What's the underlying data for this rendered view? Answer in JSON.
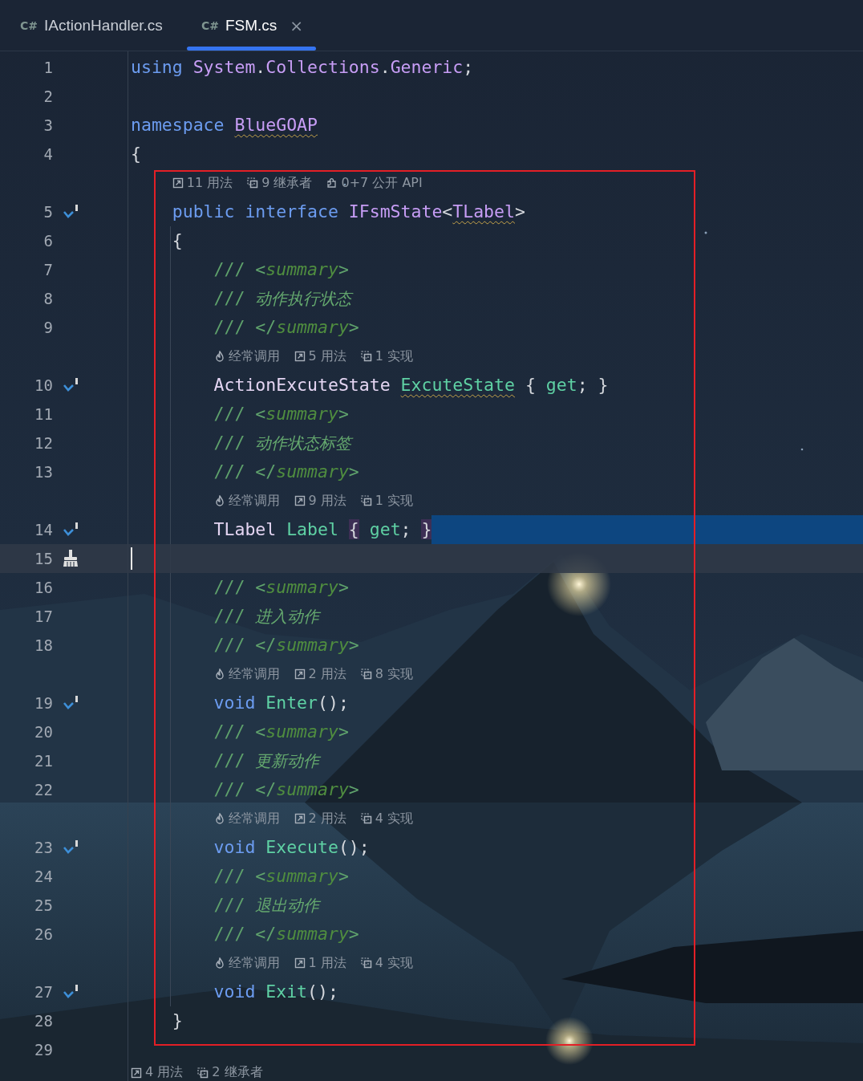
{
  "tabs": [
    {
      "lang": "C#",
      "label": "IActionHandler.cs",
      "selected": false
    },
    {
      "lang": "C#",
      "label": "FSM.cs",
      "selected": true,
      "close": "×"
    }
  ],
  "blocks": [
    {
      "boxed": false,
      "rows": [
        {
          "kind": "code",
          "number": "1",
          "tokens": [
            {
              "kind": "kw",
              "text": "using "
            },
            {
              "kind": "type",
              "text": "System"
            },
            {
              "kind": "p",
              "text": "."
            },
            {
              "kind": "type",
              "text": "Collections"
            },
            {
              "kind": "p",
              "text": "."
            },
            {
              "kind": "type",
              "text": "Generic"
            },
            {
              "kind": "p",
              "text": ";"
            }
          ]
        },
        {
          "kind": "code",
          "number": "2"
        },
        {
          "kind": "code",
          "number": "3",
          "tokens": [
            {
              "kind": "kw",
              "text": "namespace "
            },
            {
              "kind": "type",
              "text": "BlueGOAP",
              "squiggle": true
            }
          ]
        },
        {
          "kind": "code",
          "number": "4",
          "tokens": [
            {
              "kind": "p",
              "text": "{"
            }
          ]
        }
      ]
    },
    {
      "boxed": true,
      "rows": [
        {
          "kind": "hint",
          "items": [
            {
              "kind": "usages",
              "text": "11 用法"
            },
            {
              "kind": "inheritors",
              "text": "9 继承者"
            },
            {
              "kind": "api",
              "text": "0+7 公开 API"
            }
          ]
        },
        {
          "kind": "code",
          "number": "5",
          "gutter": {
            "kind": "implement"
          },
          "tokens": [
            {
              "kind": "kw",
              "text": "    public interface "
            },
            {
              "kind": "type",
              "text": "IFsmState"
            },
            {
              "kind": "p",
              "text": "<"
            },
            {
              "kind": "type",
              "text": "TLabel",
              "squiggle": true
            },
            {
              "kind": "p",
              "text": ">"
            }
          ]
        },
        {
          "kind": "code",
          "number": "6",
          "tokens": [
            {
              "kind": "p",
              "text": "    {"
            }
          ]
        },
        {
          "kind": "code",
          "number": "7",
          "tokens": [
            {
              "kind": "doc",
              "text": "        /// <"
            },
            {
              "kind": "tag",
              "text": "summary"
            },
            {
              "kind": "doc",
              "text": ">"
            }
          ]
        },
        {
          "kind": "code",
          "number": "8",
          "tokens": [
            {
              "kind": "doc",
              "text": "        /// "
            },
            {
              "kind": "note",
              "text": "动作执行状态"
            }
          ]
        },
        {
          "kind": "code",
          "number": "9",
          "tokens": [
            {
              "kind": "doc",
              "text": "        /// </"
            },
            {
              "kind": "tag",
              "text": "summary"
            },
            {
              "kind": "doc",
              "text": ">"
            }
          ]
        },
        {
          "kind": "hint",
          "items": [
            {
              "kind": "hot",
              "text": "经常调用"
            },
            {
              "kind": "usages",
              "text": "5 用法"
            },
            {
              "kind": "impl",
              "text": "1 实现"
            }
          ]
        },
        {
          "kind": "code",
          "number": "10",
          "gutter": {
            "kind": "implement"
          },
          "tokens": [
            {
              "kind": "name",
              "text": "        ActionExcuteState "
            },
            {
              "kind": "member",
              "text": "ExcuteState",
              "squiggle": true
            },
            {
              "kind": "p",
              "text": " { "
            },
            {
              "kind": "member",
              "text": "get"
            },
            {
              "kind": "p",
              "text": "; }"
            }
          ]
        },
        {
          "kind": "code",
          "number": "11",
          "tokens": [
            {
              "kind": "doc",
              "text": "        /// <"
            },
            {
              "kind": "tag",
              "text": "summary"
            },
            {
              "kind": "doc",
              "text": ">"
            }
          ]
        },
        {
          "kind": "code",
          "number": "12",
          "tokens": [
            {
              "kind": "doc",
              "text": "        /// "
            },
            {
              "kind": "note",
              "text": "动作状态标签"
            }
          ]
        },
        {
          "kind": "code",
          "number": "13",
          "tokens": [
            {
              "kind": "doc",
              "text": "        /// </"
            },
            {
              "kind": "tag",
              "text": "summary"
            },
            {
              "kind": "doc",
              "text": ">"
            }
          ]
        },
        {
          "kind": "hint",
          "items": [
            {
              "kind": "hot",
              "text": "经常调用"
            },
            {
              "kind": "usages",
              "text": "9 用法"
            },
            {
              "kind": "impl",
              "text": "1 实现"
            }
          ]
        },
        {
          "kind": "code",
          "number": "14",
          "gutter": {
            "kind": "implement"
          },
          "selected": true,
          "tokens": [
            {
              "kind": "name",
              "text": "        TLabel "
            },
            {
              "kind": "member",
              "text": "Label "
            },
            {
              "kind": "p",
              "text": "{",
              "matched": true
            },
            {
              "kind": "member",
              "text": " get"
            },
            {
              "kind": "p",
              "text": "; "
            },
            {
              "kind": "p",
              "text": "}",
              "matched": true
            }
          ]
        },
        {
          "kind": "code",
          "number": "15",
          "gutter": {
            "kind": "broom"
          },
          "current": true
        },
        {
          "kind": "code",
          "number": "16",
          "tokens": [
            {
              "kind": "doc",
              "text": "        /// <"
            },
            {
              "kind": "tag",
              "text": "summary"
            },
            {
              "kind": "doc",
              "text": ">"
            }
          ]
        },
        {
          "kind": "code",
          "number": "17",
          "tokens": [
            {
              "kind": "doc",
              "text": "        /// "
            },
            {
              "kind": "note",
              "text": "进入动作"
            }
          ]
        },
        {
          "kind": "code",
          "number": "18",
          "tokens": [
            {
              "kind": "doc",
              "text": "        /// </"
            },
            {
              "kind": "tag",
              "text": "summary"
            },
            {
              "kind": "doc",
              "text": ">"
            }
          ]
        },
        {
          "kind": "hint",
          "items": [
            {
              "kind": "hot",
              "text": "经常调用"
            },
            {
              "kind": "usages",
              "text": "2 用法"
            },
            {
              "kind": "impl",
              "text": "8 实现"
            }
          ]
        },
        {
          "kind": "code",
          "number": "19",
          "gutter": {
            "kind": "implement"
          },
          "tokens": [
            {
              "kind": "kw",
              "text": "        void "
            },
            {
              "kind": "member",
              "text": "Enter"
            },
            {
              "kind": "p",
              "text": "();"
            }
          ]
        },
        {
          "kind": "code",
          "number": "20",
          "tokens": [
            {
              "kind": "doc",
              "text": "        /// <"
            },
            {
              "kind": "tag",
              "text": "summary"
            },
            {
              "kind": "doc",
              "text": ">"
            }
          ]
        },
        {
          "kind": "code",
          "number": "21",
          "tokens": [
            {
              "kind": "doc",
              "text": "        /// "
            },
            {
              "kind": "note",
              "text": "更新动作"
            }
          ]
        },
        {
          "kind": "code",
          "number": "22",
          "tokens": [
            {
              "kind": "doc",
              "text": "        /// </"
            },
            {
              "kind": "tag",
              "text": "summary"
            },
            {
              "kind": "doc",
              "text": ">"
            }
          ]
        },
        {
          "kind": "hint",
          "items": [
            {
              "kind": "hot",
              "text": "经常调用"
            },
            {
              "kind": "usages",
              "text": "2 用法"
            },
            {
              "kind": "impl",
              "text": "4 实现"
            }
          ]
        },
        {
          "kind": "code",
          "number": "23",
          "gutter": {
            "kind": "implement"
          },
          "tokens": [
            {
              "kind": "kw",
              "text": "        void "
            },
            {
              "kind": "member",
              "text": "Execute"
            },
            {
              "kind": "p",
              "text": "();"
            }
          ]
        },
        {
          "kind": "code",
          "number": "24",
          "tokens": [
            {
              "kind": "doc",
              "text": "        /// <"
            },
            {
              "kind": "tag",
              "text": "summary"
            },
            {
              "kind": "doc",
              "text": ">"
            }
          ]
        },
        {
          "kind": "code",
          "number": "25",
          "tokens": [
            {
              "kind": "doc",
              "text": "        /// "
            },
            {
              "kind": "note",
              "text": "退出动作"
            }
          ]
        },
        {
          "kind": "code",
          "number": "26",
          "tokens": [
            {
              "kind": "doc",
              "text": "        /// </"
            },
            {
              "kind": "tag",
              "text": "summary"
            },
            {
              "kind": "doc",
              "text": ">"
            }
          ]
        },
        {
          "kind": "hint",
          "items": [
            {
              "kind": "hot",
              "text": "经常调用"
            },
            {
              "kind": "usages",
              "text": "1 用法"
            },
            {
              "kind": "impl",
              "text": "4 实现"
            }
          ]
        },
        {
          "kind": "code",
          "number": "27",
          "gutter": {
            "kind": "implement"
          },
          "tokens": [
            {
              "kind": "kw",
              "text": "        void "
            },
            {
              "kind": "member",
              "text": "Exit"
            },
            {
              "kind": "p",
              "text": "();"
            }
          ]
        },
        {
          "kind": "code",
          "number": "28",
          "tokens": [
            {
              "kind": "p",
              "text": "    }"
            }
          ]
        }
      ]
    },
    {
      "boxed": false,
      "rows": [
        {
          "kind": "code",
          "number": "29"
        },
        {
          "kind": "hint",
          "items": [
            {
              "kind": "usages",
              "text": "4 用法"
            },
            {
              "kind": "impl",
              "text": "2 继承者"
            }
          ]
        }
      ]
    }
  ]
}
